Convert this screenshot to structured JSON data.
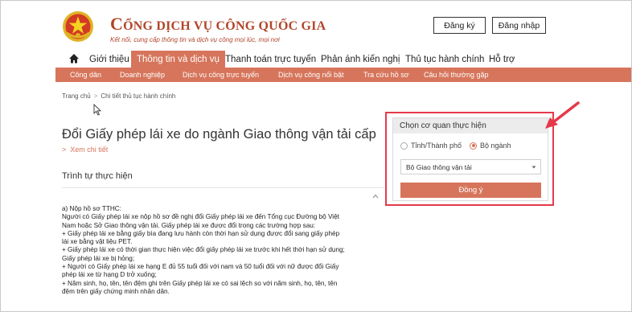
{
  "header": {
    "brand_title_first": "C",
    "brand_title_rest": "ỔNG DỊCH VỤ CÔNG QUỐC GIA",
    "brand_subtitle": "Kết nối, cung cấp thông tin và dịch vụ công mọi lúc, mọi nơi",
    "register_label": "Đăng ký",
    "login_label": "Đăng nhập"
  },
  "mainnav": {
    "items": [
      "Giới thiệu",
      "Thông tin và dịch vụ",
      "Thanh toán trực tuyến",
      "Phản ánh kiến nghị",
      "Thủ tục hành chính",
      "Hỗ trợ"
    ]
  },
  "subnav": {
    "items": [
      "Công dân",
      "Doanh nghiệp",
      "Dịch vụ công trực tuyến",
      "Dịch vụ công nổi bật",
      "Tra cứu hồ sơ",
      "Câu hỏi thường gặp"
    ]
  },
  "breadcrumb": {
    "home": "Trang chủ",
    "separator": ">",
    "current": "Chi tiết thủ tục hành chính"
  },
  "content": {
    "title": "Đổi Giấy phép lái xe do ngành Giao thông vận tải cấp",
    "detail_link": "Xem chi tiết",
    "section_title": "Trình tự thực hiện",
    "body_lines": [
      "a) Nộp hồ sơ TTHC:",
      "Người có Giấy phép lái xe nộp hồ sơ đề nghị đổi Giấy phép lái xe đến Tổng cục Đường bộ Việt",
      "Nam hoặc Sở Giao thông vận tải. Giấy phép lái xe được đổi trong các trường hợp sau:",
      "+ Giấy phép lái xe bằng giấy bìa đang lưu hành còn thời hạn sử dụng được đổi sang giấy phép",
      "lái xe bằng vật liệu PET.",
      "+ Giấy phép lái xe có thời gian thực hiện việc đổi giấy phép lái xe trước khi hết thời hạn sử dụng;",
      "Giấy phép lái xe bị hỏng;",
      "+ Người có Giấy phép lái xe hạng E đủ 55 tuổi đối với nam và 50 tuổi đối với nữ được đổi Giấy",
      "phép lái xe từ hạng D trở xuống;",
      "+ Năm sinh, họ, tên, tên đệm ghi trên Giấy phép lái xe có sai lệch so với năm sinh, họ, tên, tên",
      "đệm trên giấy chứng minh nhân dân."
    ]
  },
  "agency_panel": {
    "heading": "Chọn cơ quan thực hiện",
    "option_province": "Tỉnh/Thành phố",
    "option_ministry": "Bộ ngành",
    "selected_option": "Bộ ngành",
    "select_value": "Bộ Giao thông vận tải",
    "submit_label": "Đồng ý"
  },
  "colors": {
    "accent": "#d6755b",
    "brand": "#b1452a",
    "highlight": "#e5394a"
  }
}
